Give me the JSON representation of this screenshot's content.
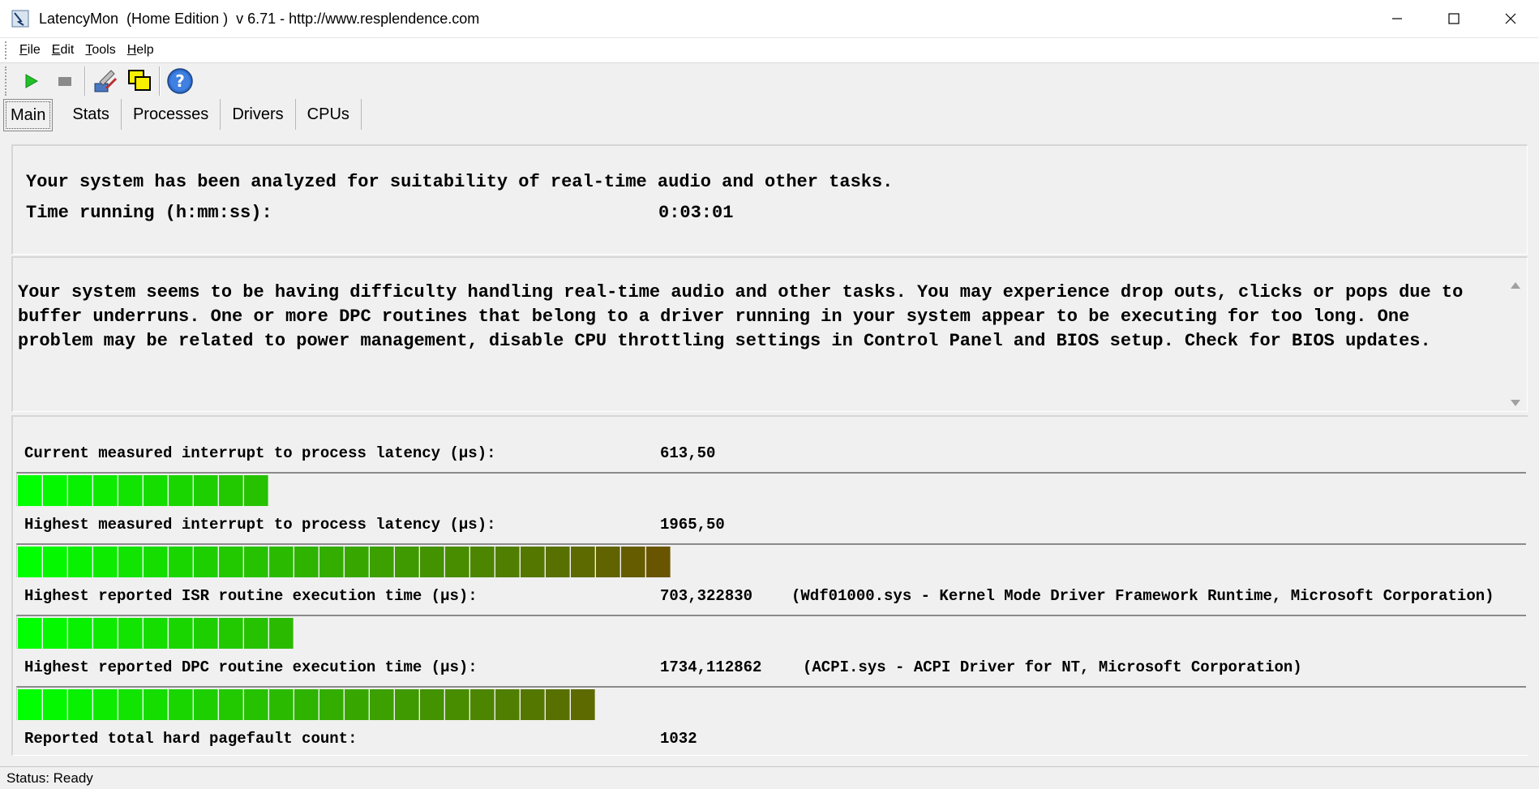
{
  "window": {
    "title": "LatencyMon  (Home Edition )  v 6.71 - http://www.resplendence.com"
  },
  "menu": {
    "items": [
      "File",
      "Edit",
      "Tools",
      "Help"
    ]
  },
  "toolbar": {
    "buttons": [
      "play-icon",
      "stop-icon",
      "tools-icon",
      "windows-icon",
      "help-icon"
    ]
  },
  "tabs": [
    "Main",
    "Stats",
    "Processes",
    "Drivers",
    "CPUs"
  ],
  "summary": {
    "line1": "Your system has been analyzed for suitability of real-time audio and other tasks.",
    "time_label": "Time running (h:mm:ss):",
    "time_value": "0:03:01"
  },
  "message": {
    "text": "Your system seems to be having difficulty handling real-time audio and other tasks. You may experience drop outs, clicks or pops due to buffer underruns. One or more DPC routines that belong to a driver running in your system appear to be executing for too long. One problem may be related to power management, disable CPU throttling settings in Control Panel and BIOS setup. Check for BIOS updates."
  },
  "metrics": [
    {
      "label": "Current measured interrupt to process latency (µs):",
      "value": "613,50",
      "extra": "",
      "segments": 10
    },
    {
      "label": "Highest measured interrupt to process latency (µs):",
      "value": "1965,50",
      "extra": "",
      "segments": 26
    },
    {
      "label": "Highest reported ISR routine execution time (µs):",
      "value": "703,322830",
      "extra": "(Wdf01000.sys - Kernel Mode Driver Framework Runtime, Microsoft Corporation)",
      "segments": 11
    },
    {
      "label": "Highest reported DPC routine execution time (µs):",
      "value": "1734,112862",
      "extra": "(ACPI.sys - ACPI Driver for NT, Microsoft Corporation)",
      "segments": 23
    },
    {
      "label": "Reported total hard pagefault count:",
      "value": "1032",
      "extra": ""
    }
  ],
  "status": {
    "text": "Status: Ready"
  },
  "colors": {
    "bar_start": "#00ff00",
    "bar_end": "#7a3a00"
  }
}
